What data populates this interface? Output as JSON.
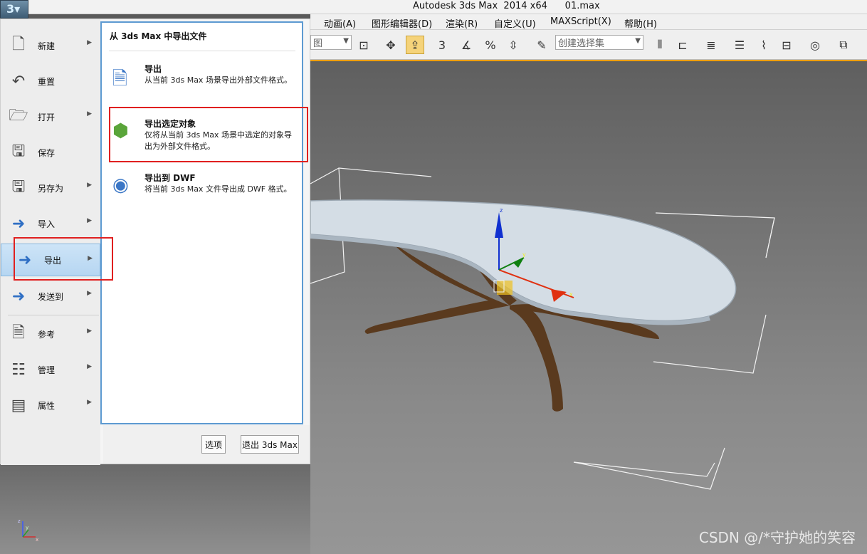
{
  "titlebar": {
    "title": "Autodesk 3ds Max  2014 x64      01.max"
  },
  "menubar": {
    "items": [
      "动画(A)",
      "图形编辑器(D)",
      "渲染(R)",
      "自定义(U)",
      "MAXScript(X)",
      "帮助(H)"
    ]
  },
  "toolbar": {
    "view_combo": "图",
    "selection_set_placeholder": "创建选择集",
    "snap_label": "3",
    "angle_label": "%"
  },
  "appmenu": {
    "items": [
      {
        "label": "新建",
        "icon": "new-file-icon",
        "has_submenu": true
      },
      {
        "label": "重置",
        "icon": "reset-icon",
        "has_submenu": false
      },
      {
        "label": "打开",
        "icon": "open-folder-icon",
        "has_submenu": true
      },
      {
        "label": "保存",
        "icon": "save-icon",
        "has_submenu": false
      },
      {
        "label": "另存为",
        "icon": "save-as-icon",
        "has_submenu": true
      },
      {
        "label": "导入",
        "icon": "import-icon",
        "has_submenu": true
      },
      {
        "label": "导出",
        "icon": "export-icon",
        "has_submenu": true
      },
      {
        "label": "发送到",
        "icon": "send-to-icon",
        "has_submenu": true
      },
      {
        "label": "参考",
        "icon": "reference-icon",
        "has_submenu": true
      },
      {
        "label": "管理",
        "icon": "manage-icon",
        "has_submenu": true
      },
      {
        "label": "属性",
        "icon": "properties-icon",
        "has_submenu": true
      }
    ],
    "submenu": {
      "heading": "从 3ds Max 中导出文件",
      "items": [
        {
          "title": "导出",
          "desc": "从当前 3ds Max 场景导出外部文件格式。"
        },
        {
          "title": "导出选定对象",
          "desc": "仅将从当前 3ds Max 场景中选定的对象导出为外部文件格式。"
        },
        {
          "title": "导出到 DWF",
          "desc": "将当前 3ds Max 文件导出成 DWF 格式。"
        }
      ]
    },
    "buttons": {
      "options": "选项",
      "exit": "退出 3ds Max"
    }
  },
  "viewport": {
    "axis_labels": [
      "z",
      "y",
      "x"
    ],
    "gizmo_labels": [
      "z",
      "y",
      "x"
    ]
  },
  "watermark": "CSDN @/*守护她的笑容"
}
